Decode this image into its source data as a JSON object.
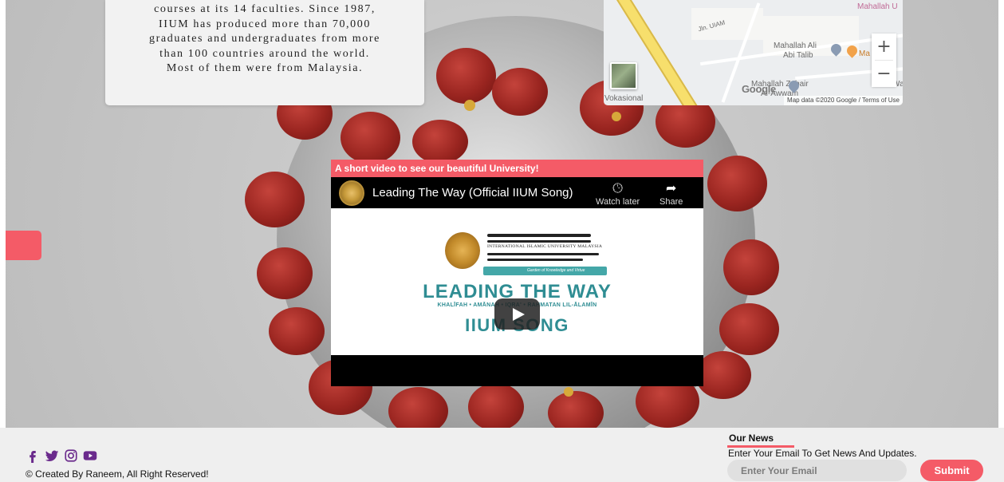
{
  "intro": {
    "lines": [
      "courses at its 14 faculties. Since 1987,",
      "IIUM has produced more than 70,000",
      "graduates and undergraduates from more",
      "than 100 countries around the world.",
      "Most of them were from Malaysia."
    ]
  },
  "map": {
    "labels": {
      "mahallah_top": "Mahallah U",
      "jln_uiam": "Jln. UIAM",
      "mahallah_ali": "Mahallah Ali",
      "abi_talib": "Abi Talib",
      "ma": "Ma",
      "mahallah_zubair": "Mahallah Zubair",
      "al_awwam": "Al-Awwam",
      "vokasional": "Vokasional",
      "wa": "Wa"
    },
    "google": "Google",
    "attribution": "Map data ©2020 Google",
    "terms": "Terms of Use",
    "zoom_in": "+",
    "zoom_out": "−"
  },
  "video": {
    "header": "A short video to see our beautiful University!",
    "title": "Leading The Way (Official IIUM Song)",
    "watch_later": "Watch later",
    "share": "Share",
    "thumbnail": {
      "university_name": "INTERNATIONAL ISLAMIC UNIVERSITY MALAYSIA",
      "tagline": "Garden of Knowledge and Virtue",
      "heading": "LEADING THE WAY",
      "motto": "KHALĪFAH • AMĀNAH • IQRA' • RAHMATAN LIL-ĀLAMĪN",
      "song": "IIUM SONG"
    }
  },
  "footer": {
    "social_icons": [
      "facebook-icon",
      "twitter-icon",
      "instagram-icon",
      "youtube-icon"
    ],
    "copyright": "© Created By Raneem, All Right Reserved!",
    "news_title": "Our News",
    "news_desc": "Enter Your Email To Get News And Updates.",
    "email_placeholder": "Enter Your Email",
    "submit": "Submit"
  },
  "colors": {
    "accent": "#f45b67",
    "brand_purple": "#6a2a8c",
    "footer_bg": "#efefef"
  }
}
